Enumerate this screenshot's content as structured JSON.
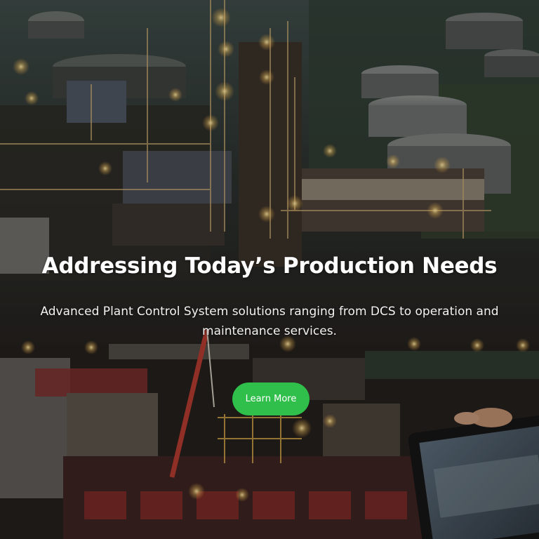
{
  "hero": {
    "headline": "Addressing Today’s Production Needs",
    "subtitle": "Advanced Plant Control System solutions ranging from DCS to operation and maintenance services.",
    "cta_label": "Learn More"
  },
  "colors": {
    "cta_background": "#2fbf4a",
    "text": "#ffffff"
  }
}
